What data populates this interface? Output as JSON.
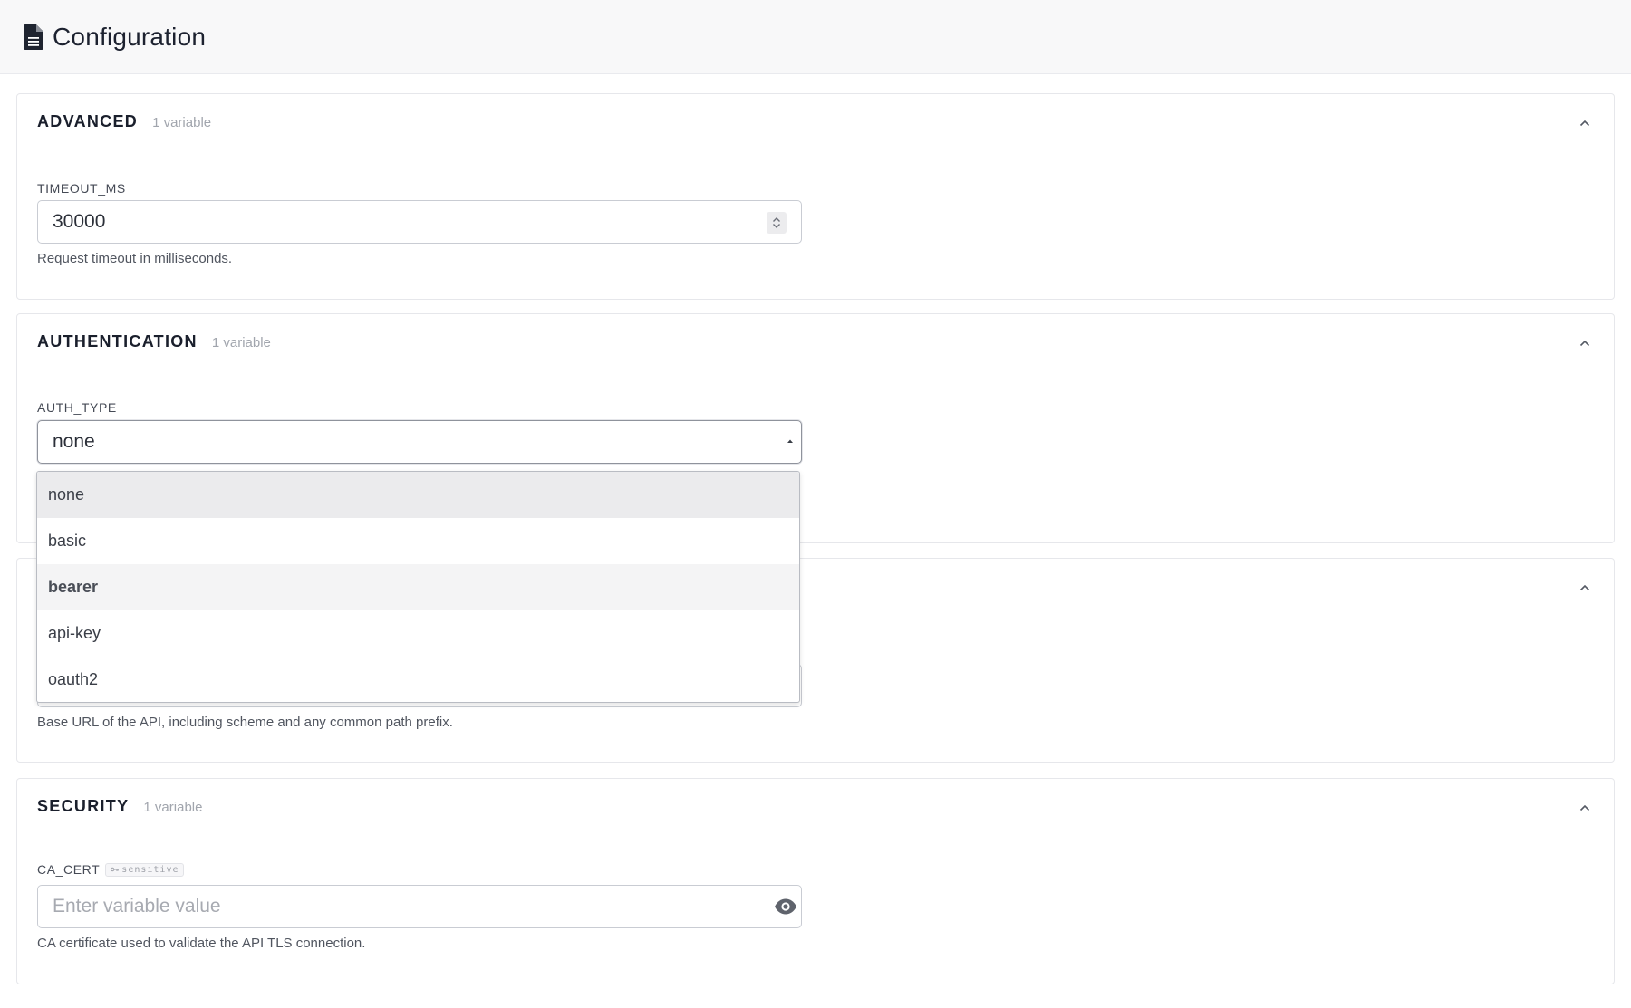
{
  "header": {
    "title": "Configuration",
    "icon": "document-icon"
  },
  "sections": {
    "advanced": {
      "title": "ADVANCED",
      "count": "1 variable",
      "field": {
        "label": "TIMEOUT_MS",
        "value": "30000",
        "help": "Request timeout in milliseconds."
      }
    },
    "authentication": {
      "title": "AUTHENTICATION",
      "count": "1 variable",
      "field": {
        "label": "AUTH_TYPE",
        "value": "none",
        "options": [
          "none",
          "basic",
          "bearer",
          "api-key",
          "oauth2"
        ],
        "selected": "none",
        "hovered": "bearer"
      }
    },
    "connection": {
      "field": {
        "help": "Base URL of the API, including scheme and any common path prefix."
      }
    },
    "security": {
      "title": "SECURITY",
      "count": "1 variable",
      "field": {
        "label": "CA_CERT",
        "badge": "sensitive",
        "placeholder": "Enter variable value",
        "help": "CA certificate used to validate the API TLS connection."
      }
    }
  },
  "colors": {
    "header_bg": "#f8f8f9",
    "border": "#e6e7eb",
    "option_selected_bg": "#ebebed",
    "option_hover_bg": "#f4f4f5"
  }
}
